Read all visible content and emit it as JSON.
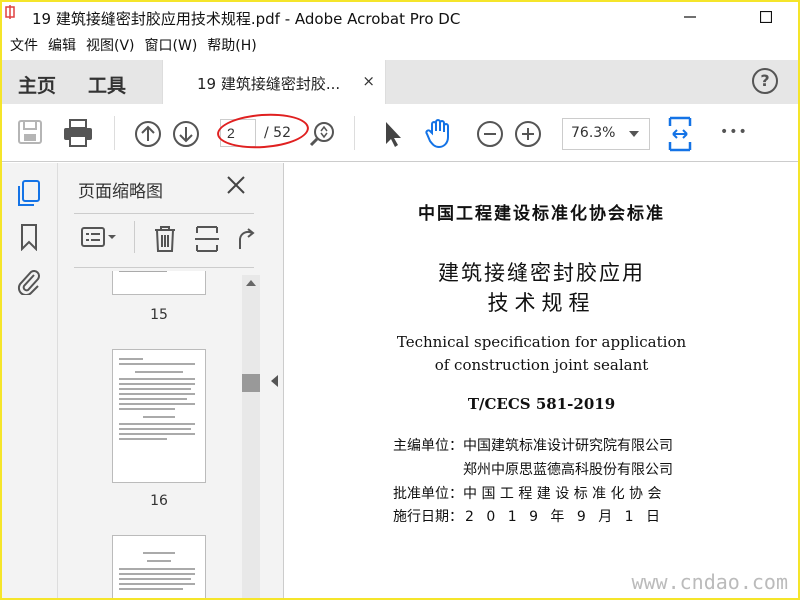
{
  "window": {
    "title": "19 建筑接缝密封胶应用技术规程.pdf - Adobe Acrobat Pro DC",
    "minimize_icon": "minimize-icon",
    "maximize_icon": "maximize-icon"
  },
  "menu": [
    "文件",
    "编辑",
    "视图(V)",
    "窗口(W)",
    "帮助(H)"
  ],
  "tabs": {
    "home": "主页",
    "tools": "工具",
    "document": "19 建筑接缝密封胶...",
    "close": "×",
    "help": "?"
  },
  "toolbar": {
    "current_page": "2",
    "total_pages": "/ 52",
    "zoom": "76.3%",
    "more": "•••"
  },
  "panel": {
    "title": "页面缩略图",
    "thumbnails": [
      {
        "number": "15"
      },
      {
        "number": "16"
      }
    ]
  },
  "document": {
    "org": "中国工程建设标准化协会标准",
    "title_line1": "建筑接缝密封胶应用",
    "title_line2": "技术规程",
    "en_line1": "Technical specification for application",
    "en_line2": "of construction joint sealant",
    "code": "T/CECS 581-2019",
    "editor_label": "主编单位：",
    "editor1": "中国建筑标准设计研究院有限公司",
    "editor2": "郑州中原思蓝德高科股份有限公司",
    "approver_label": "批准单位：",
    "approver": "中 国 工 程 建 设 标 准 化 协 会",
    "date_label": "施行日期：",
    "date": "2 0 1 9  年  9  月  1  日"
  },
  "watermark": "www.cndao.com"
}
